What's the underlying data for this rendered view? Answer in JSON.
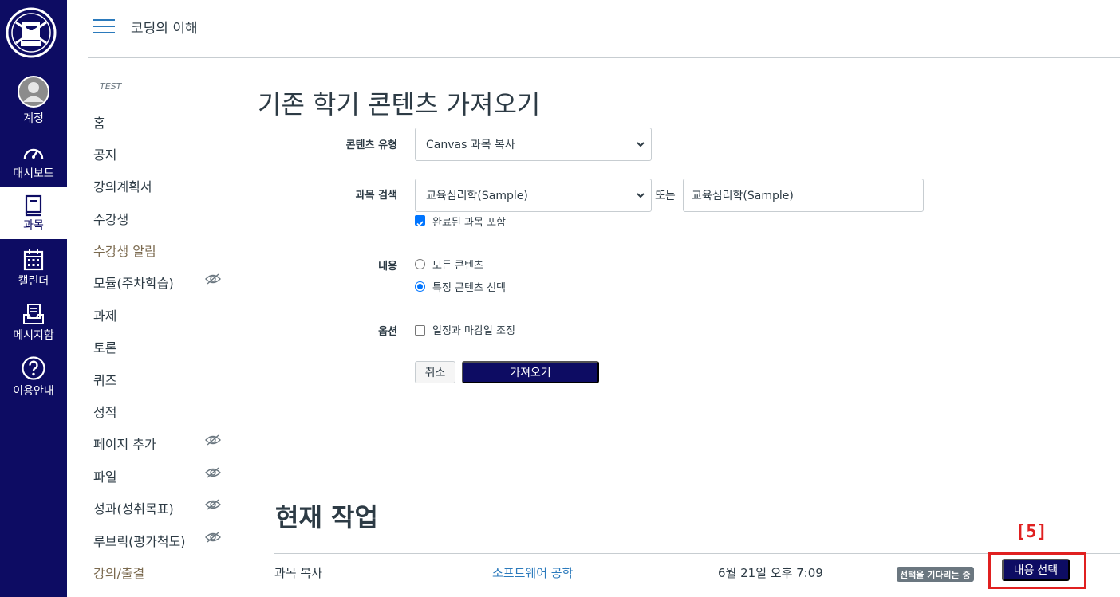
{
  "global_nav": {
    "logo_alt": "university seal",
    "items": [
      {
        "label": "계정",
        "icon": "avatar-icon"
      },
      {
        "label": "대시보드",
        "icon": "dashboard-icon"
      },
      {
        "label": "과목",
        "icon": "courses-icon",
        "active": true
      },
      {
        "label": "캘린더",
        "icon": "calendar-icon"
      },
      {
        "label": "메시지함",
        "icon": "inbox-icon"
      },
      {
        "label": "이용안내",
        "icon": "help-icon"
      }
    ]
  },
  "header": {
    "breadcrumb": "코딩의 이해"
  },
  "course_nav": {
    "term": "TEST",
    "items": [
      {
        "label": "홈"
      },
      {
        "label": "공지"
      },
      {
        "label": "강의계획서"
      },
      {
        "label": "수강생"
      },
      {
        "label": "수강생 알림",
        "muted": true
      },
      {
        "label": "모듈(주차학습)",
        "hidden_icon": true
      },
      {
        "label": "과제"
      },
      {
        "label": "토론"
      },
      {
        "label": "퀴즈"
      },
      {
        "label": "성적"
      },
      {
        "label": "페이지 추가",
        "hidden_icon": true
      },
      {
        "label": "파일",
        "hidden_icon": true
      },
      {
        "label": "성과(성취목표)",
        "hidden_icon": true
      },
      {
        "label": "루브릭(평가척도)",
        "hidden_icon": true
      },
      {
        "label": "강의/출결",
        "muted": true
      }
    ]
  },
  "main": {
    "title": "기존 학기 콘텐츠 가져오기",
    "content_type": {
      "label": "콘텐츠 유형",
      "value": "Canvas 과목 복사"
    },
    "course_search": {
      "label": "과목 검색",
      "select_value": "교육심리학(Sample)",
      "or_text": "또는",
      "input_value": "교육심리학(Sample)",
      "include_completed_label": "완료된 과목 포함",
      "include_completed_checked": true
    },
    "content": {
      "label": "내용",
      "option_all": "모든 콘텐츠",
      "option_specific": "특정 콘텐츠 선택",
      "selected": "specific"
    },
    "options": {
      "label": "옵션",
      "adjust_dates_label": "일정과 마감일 조정",
      "adjust_dates_checked": false
    },
    "buttons": {
      "cancel": "취소",
      "import": "가져오기"
    }
  },
  "current_jobs": {
    "title": "현재 작업",
    "annotation": "[5]",
    "rows": [
      {
        "type": "과목 복사",
        "source": "소프트웨어 공학",
        "date": "6월 21일 오후 7:09",
        "status": "선택을 기다리는 중",
        "action": "내용 선택"
      }
    ]
  },
  "colors": {
    "nav_bg": "#0d0c63",
    "link": "#2b7abc",
    "annotation": "#e02020"
  }
}
